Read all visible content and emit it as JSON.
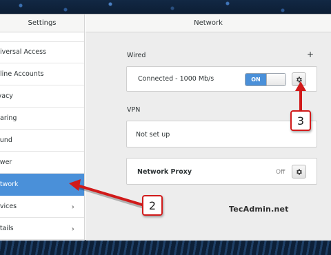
{
  "sidebar": {
    "title": "Settings",
    "items": [
      {
        "label": "niversal Access",
        "chevron": false
      },
      {
        "label": "nline Accounts",
        "chevron": false
      },
      {
        "label": "ivacy",
        "chevron": false
      },
      {
        "label": "haring",
        "chevron": false
      },
      {
        "label": "ound",
        "chevron": false
      },
      {
        "label": "ower",
        "chevron": false
      },
      {
        "label": "etwork",
        "chevron": false,
        "selected": true
      },
      {
        "label": "evices",
        "chevron": true
      },
      {
        "label": "etails",
        "chevron": true
      }
    ],
    "chevron_glyph": "›"
  },
  "main": {
    "title": "Network",
    "wired": {
      "title": "Wired",
      "add_label": "+",
      "status": "Connected - 1000 Mb/s",
      "toggle_label": "ON",
      "toggle_on": true
    },
    "vpn": {
      "title": "VPN",
      "status": "Not set up"
    },
    "proxy": {
      "label": "Network Proxy",
      "status": "Off"
    },
    "watermark": "TecAdmin.net"
  },
  "annotations": {
    "badge_2": "2",
    "badge_3": "3"
  },
  "colors": {
    "accent": "#4a90d9",
    "annotation_red": "#d11a1a"
  },
  "icons": {
    "settings_gear": "gear-icon",
    "chevron": "chevron-right-icon"
  }
}
